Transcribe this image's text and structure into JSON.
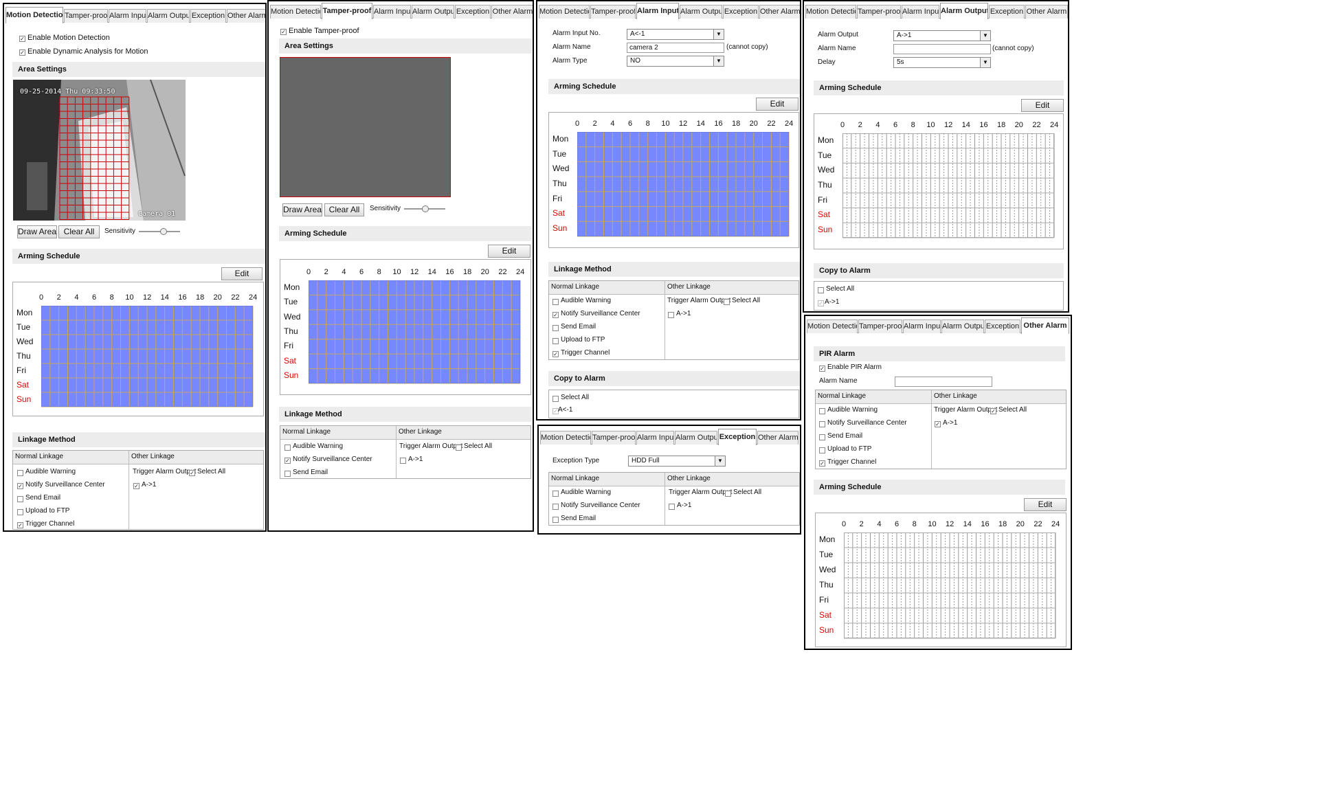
{
  "tabs": [
    "Motion Detection",
    "Tamper-proof",
    "Alarm Input",
    "Alarm Output",
    "Exception",
    "Other Alarm"
  ],
  "days": [
    "Mon",
    "Tue",
    "Wed",
    "Thu",
    "Fri",
    "Sat",
    "Sun"
  ],
  "hours": [
    "0",
    "2",
    "4",
    "6",
    "8",
    "10",
    "12",
    "14",
    "16",
    "18",
    "20",
    "22",
    "24"
  ],
  "colors": {
    "schedule_fill": "#7788ff",
    "schedule_grid": "#c7a85a",
    "weekend_label": "#e00000",
    "area_grid": "#cc0000",
    "tamper_area": "#666666"
  },
  "common": {
    "area_settings": "Area Settings",
    "arming_schedule": "Arming Schedule",
    "linkage_method": "Linkage Method",
    "copy_to_alarm": "Copy to Alarm",
    "edit": "Edit",
    "draw_area": "Draw Area",
    "clear_all": "Clear All",
    "sensitivity": "Sensitivity",
    "normal_linkage": "Normal Linkage",
    "other_linkage": "Other Linkage",
    "audible_warning": "Audible Warning",
    "notify_center": "Notify Surveillance Center",
    "send_email": "Send Email",
    "upload_ftp": "Upload to FTP",
    "trigger_channel": "Trigger Channel",
    "trigger_alarm_output": "Trigger Alarm Output",
    "select_all": "Select All",
    "cannot_copy": "(cannot copy)",
    "check": "✓",
    "dropdown_arrow": "▼"
  },
  "motion": {
    "enable_motion": "Enable Motion Detection",
    "enable_dynamic": "Enable Dynamic Analysis for Motion",
    "osd_time": "09-25-2014 Thu 09:33:50",
    "osd_camera": "Camera 01",
    "sensitivity_level": 0.6,
    "alarm_output": "A->1"
  },
  "tamper": {
    "enable_tamper": "Enable Tamper-proof",
    "sensitivity_level": 0.5,
    "alarm_output": "A->1"
  },
  "alarm_input": {
    "no_label": "Alarm Input No.",
    "no_value": "A<-1",
    "name_label": "Alarm Name",
    "name_value": "camera 2",
    "type_label": "Alarm Type",
    "type_value": "NO",
    "alarm_output": "A->1",
    "copy_item": "A<-1"
  },
  "alarm_output": {
    "output_label": "Alarm Output",
    "output_value": "A->1",
    "name_label": "Alarm Name",
    "name_value": "",
    "delay_label": "Delay",
    "delay_value": "5s",
    "copy_item": "A->1"
  },
  "exception": {
    "type_label": "Exception Type",
    "type_value": "HDD Full",
    "alarm_output": "A->1"
  },
  "other_alarm": {
    "pir_alarm": "PIR Alarm",
    "enable_pir": "Enable PIR Alarm",
    "name_label": "Alarm Name",
    "name_value": "",
    "alarm_output": "A->1"
  }
}
